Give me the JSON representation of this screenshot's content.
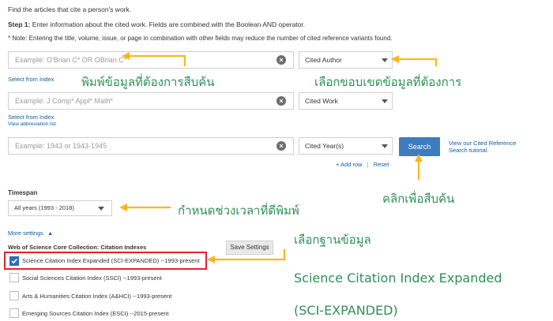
{
  "page": {
    "intro": "Find the articles that cite a person's work.",
    "step1_prefix": "Step 1:",
    "step1_text": "Enter information about the cited work. Fields are combined with the Boolean AND operator.",
    "note": "* Note: Entering the title, volume, issue, or page in combination with other fields may reduce the number of cited reference variants found."
  },
  "rows": [
    {
      "placeholder": "Example: O'Brian C* OR OBrian C*",
      "field": "Cited Author",
      "link": "Select from Index"
    },
    {
      "placeholder": "Example: J Comp* Appl* Math*",
      "field": "Cited Work",
      "link": "Select from Index",
      "link2": "View abbreviation list"
    },
    {
      "placeholder": "Example: 1943 or 1943-1945",
      "field": "Cited Year(s)"
    }
  ],
  "search_label": "Search",
  "tutorial_link": "View our Cited Reference Search tutorial.",
  "add_row": "+ Add row",
  "reset": "Reset",
  "timespan": {
    "label": "Timespan",
    "value": "All years (1993 - 2018)"
  },
  "more_settings": "More settings",
  "collection_heading": "Web of Science Core Collection: Citation Indexes",
  "save_settings": "Save Settings",
  "indexes": [
    {
      "label": "Science Citation Index Expanded (SCI-EXPANDED) --1993-present",
      "checked": true
    },
    {
      "label": "Social Sciences Citation Index (SSCI) --1993-present",
      "checked": false
    },
    {
      "label": "Arts & Humanities Citation Index (A&HCI) --1993-present",
      "checked": false
    },
    {
      "label": "Emerging Sources Citation Index (ESCI) --2015-present",
      "checked": false
    }
  ],
  "annotations": {
    "type_info": "พิมพ์ข้อมูลที่ต้องการสืบค้น",
    "choose_scope": "เลือกขอบเขตข้อมูลที่ต้องการ",
    "click_search": "คลิกเพื่อสืบค้น",
    "set_period": "กำหนดช่วงเวลาที่ตีพิมพ์",
    "choose_db": "เลือกฐานข้อมูล",
    "db_line2": "Science Citation Index Expanded",
    "db_line3": "(SCI-EXPANDED)"
  },
  "colors": {
    "arrow": "#f6b81d",
    "annotation_text": "#2f8f57",
    "search_button": "#3f7cbf",
    "highlight_box": "#e5222b"
  }
}
